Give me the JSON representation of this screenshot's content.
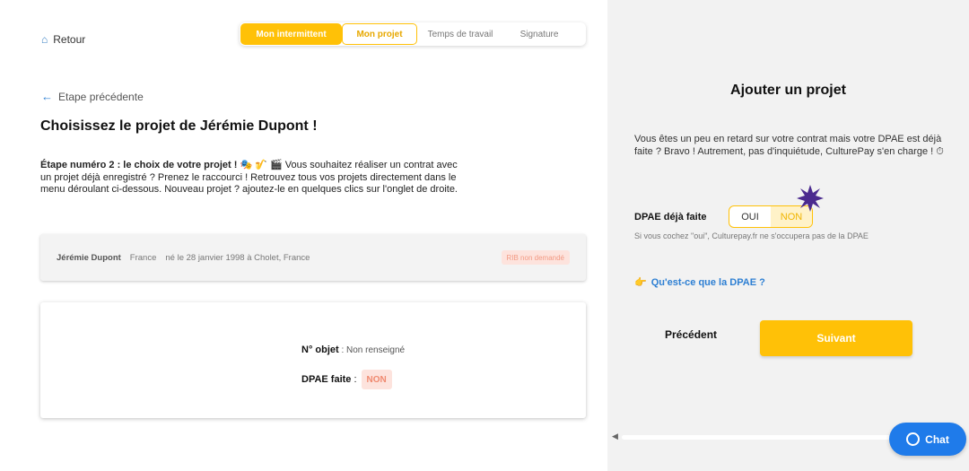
{
  "header": {
    "back_label": "Retour",
    "steps": [
      "Mon intermittent",
      "Mon projet",
      "Temps de travail",
      "Signature"
    ]
  },
  "main": {
    "prev_step_label": "Etape précédente",
    "title": "Choisissez le projet de Jérémie Dupont !",
    "intro_bold": "Étape numéro 2 : le choix de votre projet !",
    "intro_emojis": "🎭 🎷 🎬",
    "intro_text": " Vous souhaitez réaliser un contrat avec un projet déjà enregistré ? Prenez le raccourci ! Retrouvez tous vos projets directement dans le menu déroulant ci-dessous. Nouveau projet ? ajoutez-le en quelques clics sur l'onglet de droite.",
    "person": {
      "name": "Jérémie Dupont",
      "country": "France",
      "birth": "né le 28 janvier 1998 à Cholet, France",
      "rib_badge": "RIB non demandé"
    },
    "project": {
      "objet_label": "N° objet",
      "objet_value": " : Non renseigné",
      "dpae_label": "DPAE faite",
      "dpae_sep": " :",
      "dpae_value": "NON"
    }
  },
  "panel": {
    "title": "Ajouter un projet",
    "text": "Vous êtes un peu en retard sur votre contrat mais votre DPAE est déjà faite ? Bravo ! Autrement, pas d'inquiétude, CulturePay s'en charge ! ⏱",
    "dpae_label": "DPAE déjà faite",
    "toggle_oui": "OUI",
    "toggle_non": "NON",
    "hint": "Si vous cochez \"oui\", Culturepay.fr ne s'occupera pas de la DPAE",
    "link_icon": "👉",
    "link_label": "Qu'est-ce que la DPAE ?",
    "prev_label": "Précédent",
    "next_label": "Suivant"
  },
  "chat": {
    "label": "Chat"
  },
  "colors": {
    "accent": "#ffc107",
    "link": "#2d7fd3",
    "chat": "#1f7bea",
    "burst": "#4b2a8f"
  }
}
